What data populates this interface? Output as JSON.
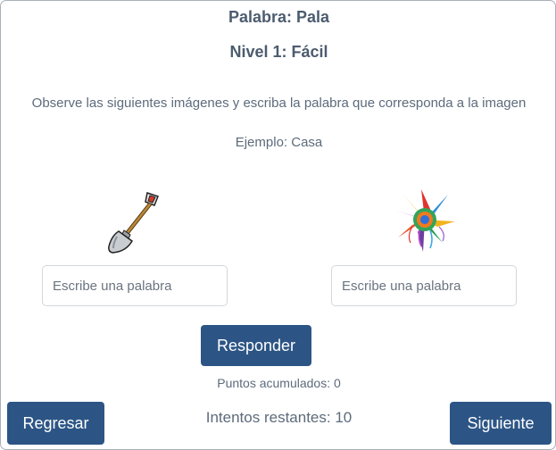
{
  "header": {
    "word_title": "Palabra: Pala",
    "level_title": "Nivel 1: Fácil"
  },
  "instructions": "Observe las siguientes imágenes y escriba la palabra que corresponda a la imagen",
  "example": "Ejemplo: Casa",
  "images": [
    {
      "icon": "shovel-icon"
    },
    {
      "icon": "pinata-icon"
    }
  ],
  "inputs": [
    {
      "placeholder": "Escribe una palabra",
      "value": ""
    },
    {
      "placeholder": "Escribe una palabra",
      "value": ""
    }
  ],
  "buttons": {
    "respond": "Responder",
    "back": "Regresar",
    "next": "Siguiente"
  },
  "status": {
    "points": "Puntos acumulados: 0",
    "attempts": "Intentos restantes: 10"
  },
  "colors": {
    "button": "#2c5585",
    "title": "#4c5c6f",
    "text": "#5d6b7c",
    "border": "#a9b0b8"
  }
}
